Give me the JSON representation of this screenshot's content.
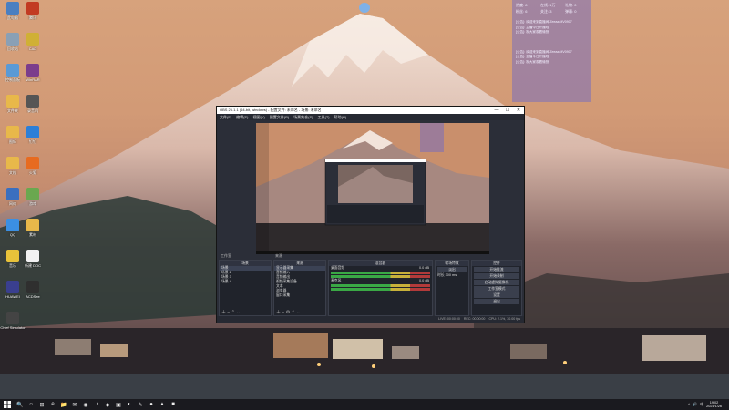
{
  "desktop": {
    "icons": [
      {
        "label": "此电脑",
        "icon": "computer-icon",
        "color": "#4a7fc1"
      },
      {
        "label": "腾讯",
        "icon": "app-icon",
        "color": "#c23b22"
      },
      {
        "label": "回收站",
        "icon": "recycle-bin-icon",
        "color": "#8aa0b5"
      },
      {
        "label": "CAD",
        "icon": "app-icon",
        "color": "#d0b035"
      },
      {
        "label": "控制面板",
        "icon": "control-panel-icon",
        "color": "#5a9ad6"
      },
      {
        "label": "WinRAR",
        "icon": "archive-icon",
        "color": "#7b3d8c"
      },
      {
        "label": "文件夹",
        "icon": "folder-icon",
        "color": "#e8b84a"
      },
      {
        "label": "录音机",
        "icon": "app-icon",
        "color": "#555555"
      },
      {
        "label": "图标",
        "icon": "folder-icon",
        "color": "#e8b84a"
      },
      {
        "label": "钉钉",
        "icon": "app-icon",
        "color": "#2d7fd8"
      },
      {
        "label": "文档",
        "icon": "folder-icon",
        "color": "#e8b84a"
      },
      {
        "label": "火狐",
        "icon": "browser-icon",
        "color": "#e76b20"
      },
      {
        "label": "网络",
        "icon": "network-icon",
        "color": "#3a6fbf"
      },
      {
        "label": "游戏",
        "icon": "game-icon",
        "color": "#6aa84f"
      },
      {
        "label": "QQ",
        "icon": "qq-icon",
        "color": "#3b8fe3"
      },
      {
        "label": "素材",
        "icon": "folder-icon",
        "color": "#e8b84a"
      },
      {
        "label": "音乐",
        "icon": "music-icon",
        "color": "#e8c23a"
      },
      {
        "label": "新建 DOC",
        "icon": "document-icon",
        "color": "#f2f2f2"
      },
      {
        "label": "HUAWEI",
        "icon": "app-icon",
        "color": "#3a3f8f"
      },
      {
        "label": "ACDSee",
        "icon": "app-icon",
        "color": "#2f2f2f"
      },
      {
        "label": "Chief Simulator",
        "icon": "app-icon",
        "color": "#444444"
      }
    ]
  },
  "overlay": {
    "stats": [
      {
        "label": "热度",
        "value": "8"
      },
      {
        "label": "在线",
        "value": "1万"
      },
      {
        "label": "礼物",
        "value": "0"
      },
      {
        "label": "粉丝",
        "value": "6"
      },
      {
        "label": "关注",
        "value": "3"
      },
      {
        "label": "弹幕",
        "value": "0"
      }
    ],
    "messages_top": [
      "[公告]: 欢迎来到直播间 Zeeaz/MV0907",
      "[公告]: 主播今日开播啦",
      "[公告]: 祝大家观看愉快"
    ],
    "messages_bottom": [
      "[公告]: 欢迎来到直播间 Zeeaz/MV0907",
      "[公告]: 主播今日开播啦",
      "[公告]: 祝大家观看愉快"
    ]
  },
  "obs": {
    "title": "OBS 26.1.1 (64-bit, windows) - 配置文件: 未命名 - 场景: 未命名",
    "window_buttons": {
      "minimize": "—",
      "maximize": "☐",
      "close": "✕"
    },
    "menu": [
      "文件(F)",
      "编辑(E)",
      "视图(V)",
      "配置文件(P)",
      "场景集合(S)",
      "工具(T)",
      "帮助(H)"
    ],
    "studio_label": "工作室",
    "source_label": "来源",
    "docks": {
      "scenes": {
        "title": "场景",
        "items": [
          "场景",
          "场景 2",
          "场景 3",
          "场景 4"
        ]
      },
      "sources": {
        "title": "来源",
        "items": [
          "显示器采集",
          "音频输入",
          "音频输出",
          "视频采集设备",
          "文本",
          "浏览器",
          "窗口采集"
        ]
      },
      "mixer": {
        "title": "混音器",
        "channels": [
          {
            "name": "桌面音频",
            "level": "0.0 dB"
          },
          {
            "name": "麦克风",
            "level": "0.0 dB"
          }
        ]
      },
      "transitions": {
        "title": "转场特效",
        "type": "淡出",
        "duration_label": "时长",
        "duration": "300 ms"
      },
      "controls": {
        "title": "控件",
        "buttons": [
          "开始推流",
          "开始录制",
          "启动虚拟摄像机",
          "工作室模式",
          "设置",
          "退出"
        ]
      }
    },
    "status": [
      "LIVE: 00:00:00",
      "REC: 00:00:00",
      "CPU: 2.1%, 30.00 fps"
    ]
  },
  "taskbar": {
    "apps": [
      "🔍",
      "○",
      "⊞",
      "e",
      "📁",
      "✉",
      "◉",
      "♪",
      "◆",
      "▣",
      "◐",
      "✎",
      "●",
      "▲",
      "■"
    ],
    "tray": [
      "^",
      "🔊",
      "中"
    ],
    "time": "19:02",
    "date": "2021/1/26"
  }
}
